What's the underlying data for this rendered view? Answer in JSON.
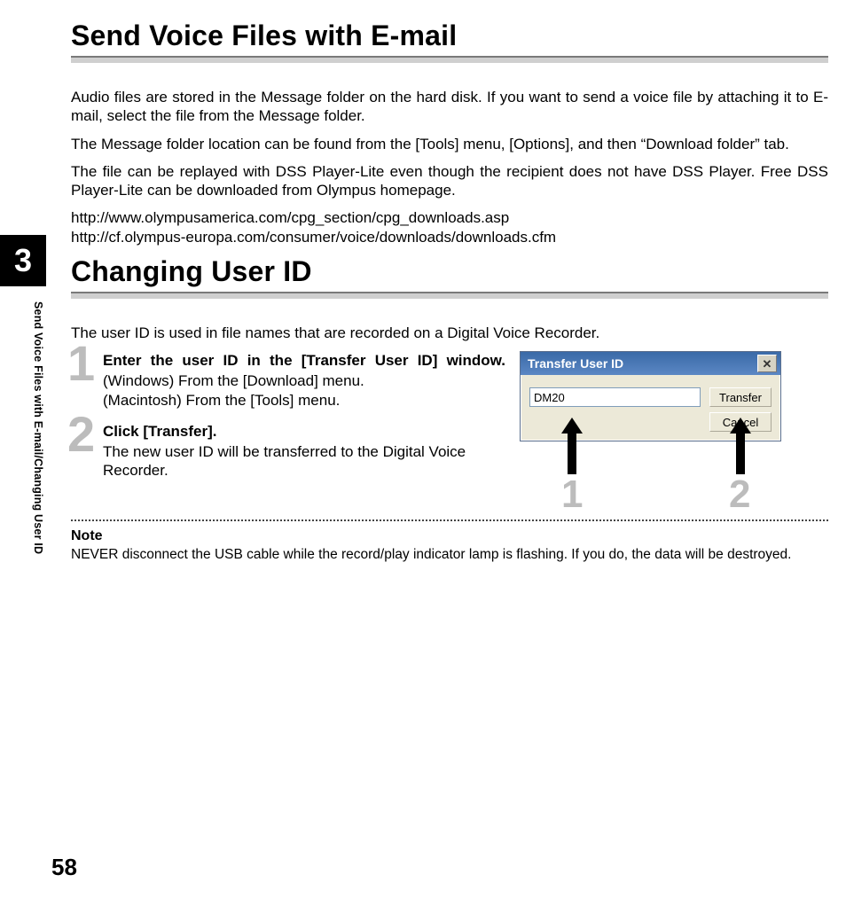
{
  "chapter_number": "3",
  "sidebar_label": "Send Voice Files with E-mail/Changing User ID",
  "page_number": "58",
  "section1": {
    "title": "Send Voice Files with E-mail",
    "p1": "Audio files are stored in the Message folder on the hard disk. If you want to send a voice file by attaching it to E-mail, select the file from the Message folder.",
    "p2": "The Message folder location can be found from the [Tools] menu, [Options], and then “Download folder” tab.",
    "p3": "The file can be replayed with DSS Player-Lite even though the recipient does not have DSS Player. Free DSS Player-Lite can be downloaded from Olympus homepage.",
    "url1": "http://www.olympusamerica.com/cpg_section/cpg_downloads.asp",
    "url2": "http://cf.olympus-europa.com/consumer/voice/downloads/downloads.cfm"
  },
  "section2": {
    "title": "Changing User ID",
    "intro": "The user ID is used in file names that are recorded on a Digital Voice Recorder.",
    "steps": [
      {
        "num": "1",
        "title": "Enter the user ID in the [Transfer User ID] window.",
        "body_line1": "(Windows) From the [Download] menu.",
        "body_line2": "(Macintosh) From the [Tools] menu."
      },
      {
        "num": "2",
        "title": "Click [Transfer].",
        "body": "The new user ID will be transferred to the Digital Voice Recorder."
      }
    ],
    "callouts": {
      "c1": "1",
      "c2": "2"
    }
  },
  "dialog": {
    "title": "Transfer User ID",
    "input_value": "DM20",
    "buttons": {
      "transfer": "Transfer",
      "cancel": "Cancel"
    },
    "close_glyph": "✕"
  },
  "note": {
    "label": "Note",
    "body": "NEVER disconnect the USB cable while the record/play indicator lamp is flashing. If you do, the data will be destroyed."
  }
}
